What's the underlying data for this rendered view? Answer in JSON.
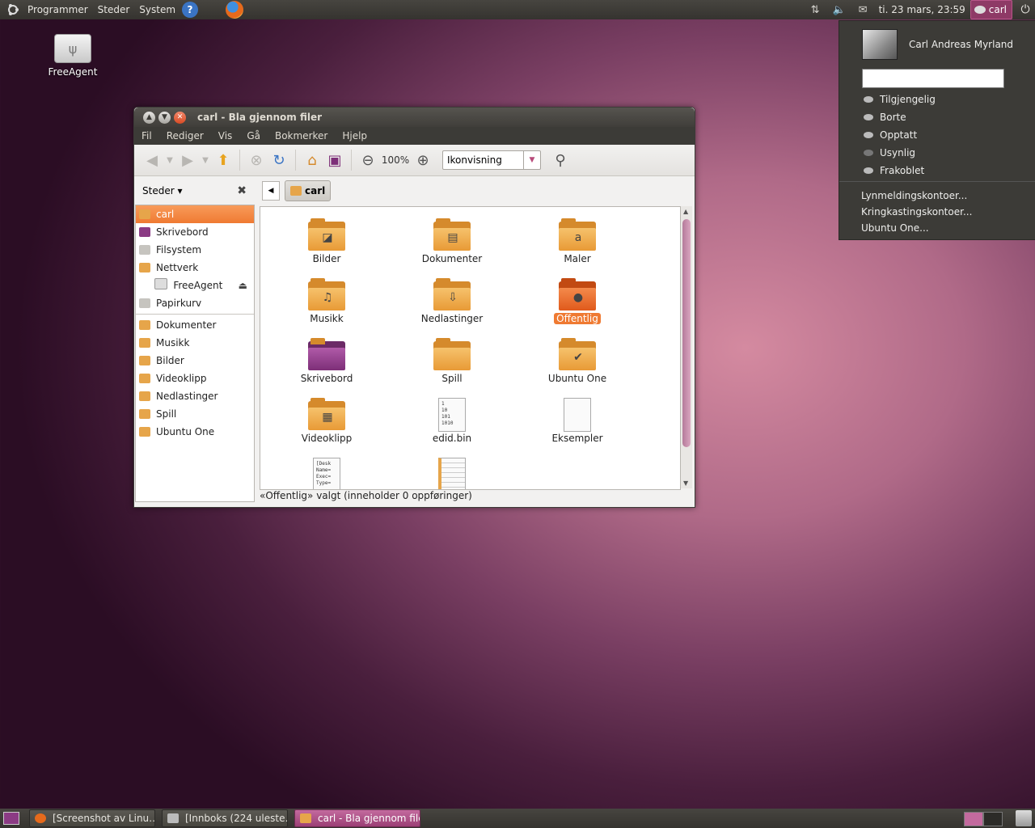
{
  "top_panel": {
    "menus": [
      "Programmer",
      "Steder",
      "System"
    ],
    "help_label": "?",
    "clock": "ti. 23 mars, 23:59",
    "user": "carl"
  },
  "desktop": {
    "icons": [
      {
        "label": "FreeAgent"
      }
    ]
  },
  "user_menu": {
    "full_name": "Carl Andreas Myrland",
    "status_input_value": "",
    "statuses": [
      "Tilgjengelig",
      "Borte",
      "Opptatt",
      "Usynlig",
      "Frakoblet"
    ],
    "accounts": [
      "Lynmeldingskontoer...",
      "Kringkastingskontoer...",
      "Ubuntu One..."
    ]
  },
  "window": {
    "title": "carl - Bla gjennom filer",
    "menubar": [
      "Fil",
      "Rediger",
      "Vis",
      "Gå",
      "Bokmerker",
      "Hjelp"
    ],
    "toolbar": {
      "zoom": "100%",
      "view_mode": "Ikonvisning"
    },
    "sidebar": {
      "header": "Steder ▾",
      "places": [
        "carl",
        "Skrivebord",
        "Filsystem",
        "Nettverk",
        "FreeAgent",
        "Papirkurv"
      ],
      "bookmarks": [
        "Dokumenter",
        "Musikk",
        "Bilder",
        "Videoklipp",
        "Nedlastinger",
        "Spill",
        "Ubuntu One"
      ]
    },
    "path": "carl",
    "items": [
      {
        "label": "Bilder",
        "kind": "folder",
        "emblem": "◪"
      },
      {
        "label": "Dokumenter",
        "kind": "folder",
        "emblem": "▤"
      },
      {
        "label": "Maler",
        "kind": "folder",
        "emblem": "a"
      },
      {
        "label": "Musikk",
        "kind": "folder",
        "emblem": "♫"
      },
      {
        "label": "Nedlastinger",
        "kind": "folder",
        "emblem": "⇩"
      },
      {
        "label": "Offentlig",
        "kind": "folder-orange",
        "emblem": "●"
      },
      {
        "label": "Skrivebord",
        "kind": "folder-purple",
        "emblem": ""
      },
      {
        "label": "Spill",
        "kind": "folder",
        "emblem": ""
      },
      {
        "label": "Ubuntu One",
        "kind": "folder",
        "emblem": "✔"
      },
      {
        "label": "Videoklipp",
        "kind": "folder",
        "emblem": "▦"
      },
      {
        "label": "edid.bin",
        "kind": "binary-file",
        "content": "1\n10\n101\n1010"
      },
      {
        "label": "Eksempler",
        "kind": "file",
        "content": ""
      },
      {
        "label": "",
        "kind": "text-file",
        "content": "[Desk\nName=\nExec=\nType="
      },
      {
        "label": "",
        "kind": "doc-file",
        "content": ""
      }
    ],
    "status": "«Offentlig» valgt (inneholder 0 oppføringer)"
  },
  "bottom_panel": {
    "tasks": [
      {
        "label": "[Screenshot av Linu…",
        "active": false
      },
      {
        "label": "[Innboks (224 uleste…",
        "active": false
      },
      {
        "label": "carl - Bla gjennom filer",
        "active": true
      }
    ]
  }
}
